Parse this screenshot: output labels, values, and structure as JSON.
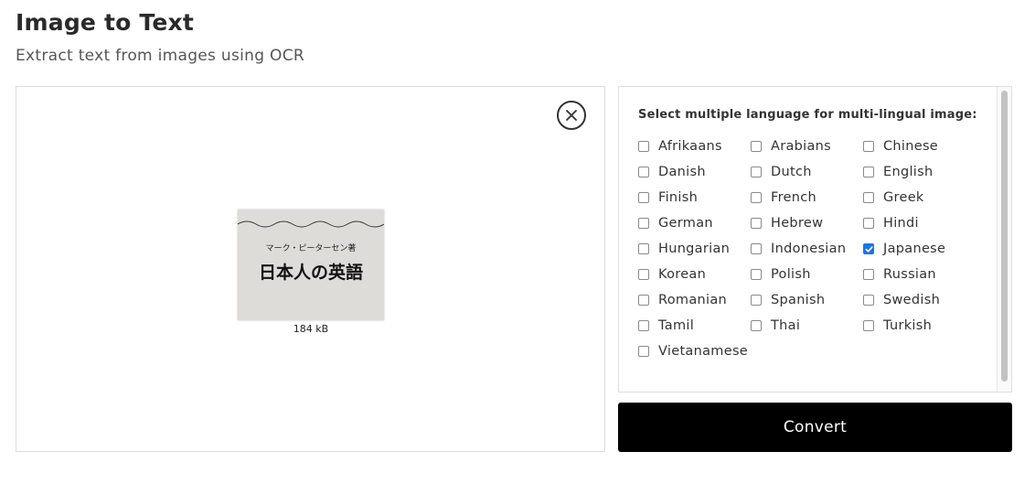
{
  "header": {
    "title": "Image to Text",
    "subtitle": "Extract text from images using OCR"
  },
  "upload": {
    "close_icon": "close-circle-icon",
    "preview": {
      "image_text_small": "マーク・ピーターセン著",
      "image_text_large": "日本人の英語",
      "file_size": "184 kB"
    }
  },
  "languages": {
    "heading": "Select multiple language for multi-lingual image:",
    "items": [
      {
        "label": "Afrikaans",
        "checked": false
      },
      {
        "label": "Arabians",
        "checked": false
      },
      {
        "label": "Chinese",
        "checked": false
      },
      {
        "label": "Danish",
        "checked": false
      },
      {
        "label": "Dutch",
        "checked": false
      },
      {
        "label": "English",
        "checked": false
      },
      {
        "label": "Finish",
        "checked": false
      },
      {
        "label": "French",
        "checked": false
      },
      {
        "label": "Greek",
        "checked": false
      },
      {
        "label": "German",
        "checked": false
      },
      {
        "label": "Hebrew",
        "checked": false
      },
      {
        "label": "Hindi",
        "checked": false
      },
      {
        "label": "Hungarian",
        "checked": false
      },
      {
        "label": "Indonesian",
        "checked": false
      },
      {
        "label": "Japanese",
        "checked": true
      },
      {
        "label": "Korean",
        "checked": false
      },
      {
        "label": "Polish",
        "checked": false
      },
      {
        "label": "Russian",
        "checked": false
      },
      {
        "label": "Romanian",
        "checked": false
      },
      {
        "label": "Spanish",
        "checked": false
      },
      {
        "label": "Swedish",
        "checked": false
      },
      {
        "label": "Tamil",
        "checked": false
      },
      {
        "label": "Thai",
        "checked": false
      },
      {
        "label": "Turkish",
        "checked": false
      },
      {
        "label": "Vietanamese",
        "checked": false
      }
    ]
  },
  "actions": {
    "convert_label": "Convert"
  },
  "colors": {
    "accent": "#1f74e0",
    "button_bg": "#000000"
  }
}
